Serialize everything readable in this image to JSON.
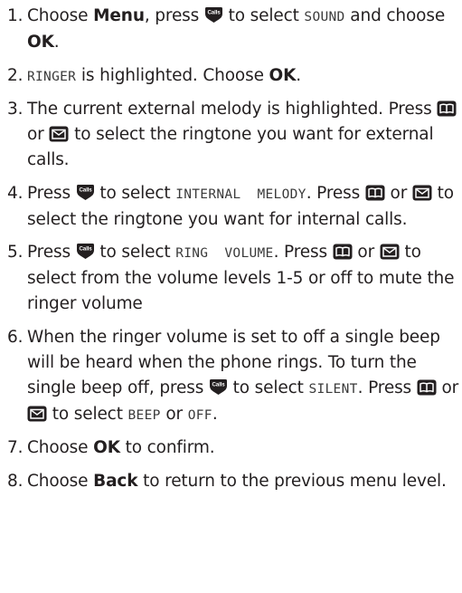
{
  "icons": {
    "calls_key": "calls-down-key-icon",
    "phonebook_key": "phonebook-key-icon",
    "message_key": "envelope-key-icon",
    "calls_key_text": "Calls"
  },
  "steps": [
    {
      "num": "1.",
      "t1": "Choose ",
      "b1": "Menu",
      "t2": ", press ",
      "t3": " to select ",
      "lcd1": "SOUND",
      "t4": " and choose ",
      "b2": "OK",
      "t5": "."
    },
    {
      "num": "2.",
      "lcd1": "RINGER",
      "t1": " is highlighted. Choose ",
      "b1": "OK",
      "t2": "."
    },
    {
      "num": "3.",
      "t1": "The current external melody is highlighted. Press ",
      "t2": " or ",
      "t3": " to select the ringtone you want for external calls."
    },
    {
      "num": "4.",
      "t1": "Press ",
      "t2": " to select ",
      "lcd1": "INTERNAL  MELODY",
      "t3": ". Press ",
      "t4": " or ",
      "t5": " to select the ringtone you want for internal calls."
    },
    {
      "num": "5.",
      "t1": "Press ",
      "t2": " to select ",
      "lcd1": "RING  VOLUME",
      "t3": ". Press ",
      "t4": " or ",
      "t5": " to select from the volume levels 1-5 or off to mute the ringer volume"
    },
    {
      "num": "6.",
      "t1": "When the ringer volume is set to off a single beep will be heard when the phone rings. To turn the single beep off, press ",
      "t2": " to select ",
      "lcd1": "SILENT",
      "t3": ". Press ",
      "t4": " or ",
      "t5": " to select ",
      "lcd2": "BEEP",
      "t6": " or ",
      "lcd3": "OFF",
      "t7": "."
    },
    {
      "num": "7.",
      "t1": "Choose ",
      "b1": "OK",
      "t2": " to confirm."
    },
    {
      "num": "8.",
      "t1": "Choose ",
      "b1": "Back",
      "t2": " to return to the previous menu level."
    }
  ]
}
